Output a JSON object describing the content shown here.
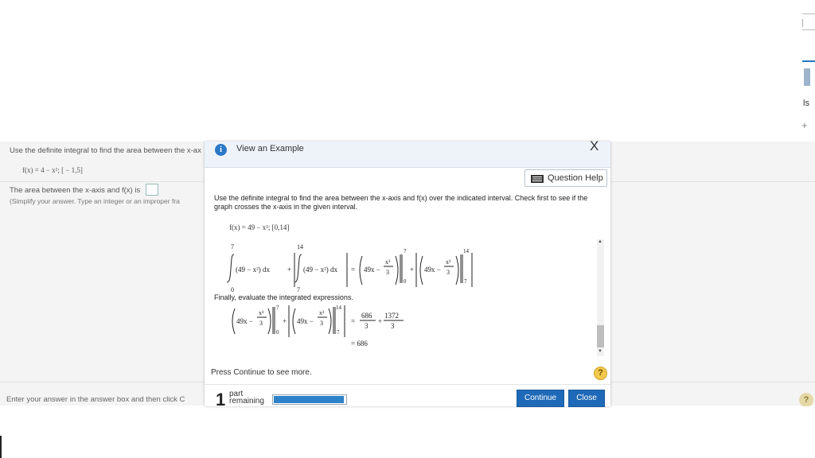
{
  "background": {
    "question_text": "Use the definite integral to find the area between the x-ax",
    "function_text": "f(x) = 4 − x²; [ − 1,5]",
    "area_label": "The area between the x-axis and f(x) is",
    "simplify_hint": "(Simplify your answer. Type an integer or an improper fra",
    "footer_text": "Enter your answer in the answer box and then click C",
    "help_symbol": "?",
    "right_label": "ls",
    "right_plus": "+"
  },
  "modal": {
    "info_icon": "i",
    "view_example": "View an Example",
    "close_symbol": "X",
    "question_help_label": "Question Help",
    "instructions": "Use the definite integral to find the area between the x-axis and f(x) over the indicated interval. Check first to see if the graph crosses the x-axis in the given interval.",
    "function": "f(x) = 49 − x²; [0,14]",
    "math": {
      "upper_a": "7",
      "lower_a": "0",
      "upper_b": "14",
      "lower_b": "7",
      "integrand": "(49 − x²) dx",
      "plus": "+",
      "eq": "=",
      "antideriv": "49x −",
      "frac_num": "x³",
      "frac_den": "3",
      "res_num1": "686",
      "res_den1": "3",
      "res_num2": "1372",
      "res_den2": "3",
      "final": "= 686"
    },
    "finally_text": "Finally, evaluate the integrated expressions.",
    "press_continue": "Press Continue to see more.",
    "help_symbol": "?",
    "parts_remaining_count": "1",
    "parts_remaining_label": "part remaining",
    "progress_fraction": 0.98,
    "continue_label": "Continue",
    "close_label": "Close",
    "scroll_up": "▲",
    "scroll_down": "▼"
  },
  "colors": {
    "accent": "#1f6ab8",
    "info_blue": "#2b78c6",
    "help_yellow": "#f2c94c"
  }
}
